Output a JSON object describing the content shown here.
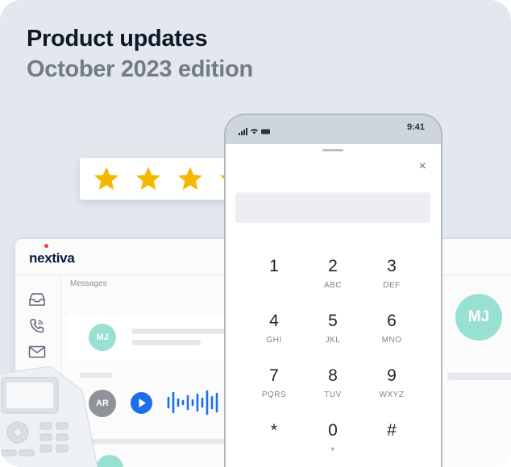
{
  "header": {
    "title": "Product updates",
    "subtitle": "October 2023 edition"
  },
  "rating": {
    "stars": 4,
    "max_stars": 4,
    "star_color": "#f5b800"
  },
  "desktop_app": {
    "logo": "nextiva",
    "logo_accent_color": "#e8413c",
    "rail_icons": [
      "inbox-icon",
      "phone-icon",
      "mail-icon"
    ],
    "messages_label": "Messages",
    "conversations": [
      {
        "initials": "MJ",
        "avatar_color": "#98e0d2"
      },
      {
        "initials": "AR",
        "avatar_color": "#8f9399",
        "voicemail": true
      }
    ],
    "contact_avatar_initials": "MJ"
  },
  "phone": {
    "status_time": "9:41",
    "close_label": "×",
    "keypad": [
      {
        "num": "1",
        "letters": ""
      },
      {
        "num": "2",
        "letters": "ABC"
      },
      {
        "num": "3",
        "letters": "DEF"
      },
      {
        "num": "4",
        "letters": "GHI"
      },
      {
        "num": "5",
        "letters": "JKL"
      },
      {
        "num": "6",
        "letters": "MNO"
      },
      {
        "num": "7",
        "letters": "PQRS"
      },
      {
        "num": "8",
        "letters": "TUV"
      },
      {
        "num": "9",
        "letters": "WXYZ"
      },
      {
        "num": "*",
        "letters": ""
      },
      {
        "num": "0",
        "letters": "+"
      },
      {
        "num": "#",
        "letters": ""
      }
    ]
  },
  "colors": {
    "background": "#e3e8ee",
    "title": "#101828",
    "subtitle": "#737b86",
    "accent_blue": "#1a6fe8"
  }
}
